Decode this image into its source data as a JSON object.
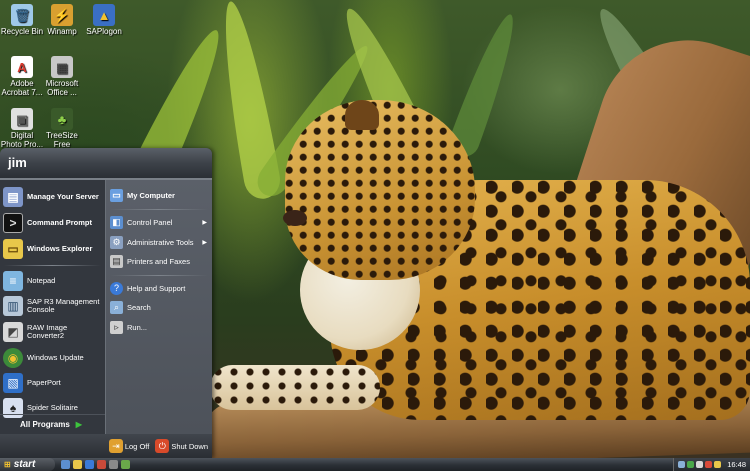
{
  "desktop": {
    "icons": [
      {
        "label": "Recycle Bin",
        "icon": "recycle-bin-icon",
        "glyph": "🗑",
        "color": "#9fc9e8"
      },
      {
        "label": "Winamp",
        "icon": "winamp-icon",
        "glyph": "⚡",
        "color": "#d9a030"
      },
      {
        "label": "SAPlogon",
        "icon": "saplogon-icon",
        "glyph": "▲",
        "color": "#3a6fc4"
      },
      {
        "label": "Adobe Acrobat 7...",
        "icon": "adobe-acrobat-icon",
        "glyph": "A",
        "color": "#d83a2e"
      },
      {
        "label": "Microsoft Office ...",
        "icon": "microsoft-office-icon",
        "glyph": "▦",
        "color": "#c8c8c8"
      },
      {
        "label": "Digital Photo Pro...",
        "icon": "digital-photo-icon",
        "glyph": "▣",
        "color": "#e0e0e0"
      },
      {
        "label": "TreeSize Free",
        "icon": "treesize-icon",
        "glyph": "♣",
        "color": "#5fa83a"
      }
    ]
  },
  "start_menu": {
    "user": "jim",
    "left_items": [
      {
        "label": "Manage Your Server",
        "icon": "server-icon",
        "glyph": "▤",
        "color": "#7e95c8",
        "bold": true
      },
      {
        "label": "Command Prompt",
        "icon": "command-prompt-icon",
        "glyph": ">",
        "color": "#1a1a1a",
        "bold": true
      },
      {
        "label": "Windows Explorer",
        "icon": "folder-explorer-icon",
        "glyph": "▭",
        "color": "#e8c74a",
        "bold": true
      },
      {
        "label": "Notepad",
        "icon": "notepad-icon",
        "glyph": "≡",
        "color": "#7fb6e0",
        "bold": false
      },
      {
        "label": "SAP R3 Management Console",
        "icon": "sap-console-icon",
        "glyph": "▥",
        "color": "#b8c8d8",
        "bold": false
      },
      {
        "label": "RAW Image Converter2",
        "icon": "raw-converter-icon",
        "glyph": "◩",
        "color": "#d8d8d8",
        "bold": false
      },
      {
        "label": "Windows Update",
        "icon": "windows-update-icon",
        "glyph": "◉",
        "color": "#3c8a3a",
        "bold": false
      },
      {
        "label": "PaperPort",
        "icon": "paperport-icon",
        "glyph": "▧",
        "color": "#2f6fc8",
        "bold": false
      },
      {
        "label": "Spider Solitaire",
        "icon": "spider-solitaire-icon",
        "glyph": "♠",
        "color": "#d8e0f0",
        "bold": false
      }
    ],
    "all_programs": "All Programs",
    "right_items": [
      {
        "label": "My Computer",
        "icon": "my-computer-icon",
        "glyph": "▭",
        "color": "#6a9fe0",
        "bold": true,
        "arrow": false
      },
      {
        "label": "Control Panel",
        "icon": "control-panel-icon",
        "glyph": "◧",
        "color": "#5c8fd0",
        "bold": false,
        "arrow": true
      },
      {
        "label": "Administrative Tools",
        "icon": "admin-tools-icon",
        "glyph": "⚙",
        "color": "#8aa0c0",
        "bold": false,
        "arrow": true
      },
      {
        "label": "Printers and Faxes",
        "icon": "printer-icon",
        "glyph": "▤",
        "color": "#c8c8c8",
        "bold": false,
        "arrow": false
      },
      {
        "label": "Help and Support",
        "icon": "help-icon",
        "glyph": "?",
        "color": "#3a7ad8",
        "bold": false,
        "arrow": false
      },
      {
        "label": "Search",
        "icon": "search-icon",
        "glyph": "⌕",
        "color": "#8ab0d8",
        "bold": false,
        "arrow": false
      },
      {
        "label": "Run...",
        "icon": "run-icon",
        "glyph": "▹",
        "color": "#d0d0d0",
        "bold": false,
        "arrow": false
      }
    ],
    "log_off": "Log Off",
    "shut_down": "Shut Down"
  },
  "taskbar": {
    "start_label": "start",
    "clock": "16:48",
    "quick_launch": [
      {
        "icon": "show-desktop-icon",
        "color": "#5c8fd0"
      },
      {
        "icon": "explorer-icon",
        "color": "#e8c74a"
      },
      {
        "icon": "ie-icon",
        "color": "#3a7ad8"
      },
      {
        "icon": "media-icon",
        "color": "#c84a3a"
      },
      {
        "icon": "app-icon",
        "color": "#8a8a8a"
      },
      {
        "icon": "app2-icon",
        "color": "#6aa84a"
      }
    ],
    "tray": [
      {
        "icon": "tray-network-icon",
        "color": "#8ab0d8"
      },
      {
        "icon": "tray-shield-icon",
        "color": "#4aa84a"
      },
      {
        "icon": "tray-volume-icon",
        "color": "#d8d8d8"
      },
      {
        "icon": "tray-antivirus-icon",
        "color": "#d84a3a"
      },
      {
        "icon": "tray-app-icon",
        "color": "#e8c74a"
      }
    ]
  }
}
